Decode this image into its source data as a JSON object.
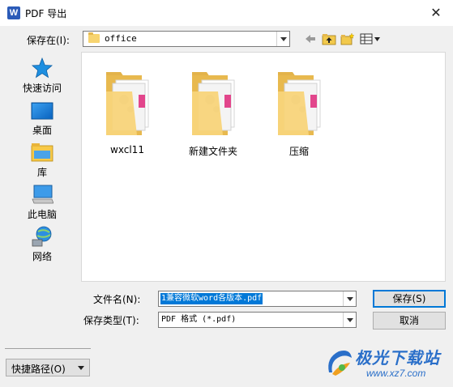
{
  "window": {
    "title": "PDF 导出",
    "app_icon": "W"
  },
  "toolbar": {
    "look_in_label": "保存在(I):",
    "look_in_value": "office"
  },
  "places": [
    {
      "label": "快速访问",
      "icon": "star-icon"
    },
    {
      "label": "桌面",
      "icon": "desktop-icon"
    },
    {
      "label": "库",
      "icon": "library-icon"
    },
    {
      "label": "此电脑",
      "icon": "computer-icon"
    },
    {
      "label": "网络",
      "icon": "network-icon"
    }
  ],
  "files": [
    {
      "name": "wxcl11"
    },
    {
      "name": "新建文件夹"
    },
    {
      "name": "压缩"
    }
  ],
  "form": {
    "filename_label": "文件名(N):",
    "filename_value": "1兼容微软word各版本.pdf",
    "filetype_label": "保存类型(T):",
    "filetype_value": "PDF 格式 (*.pdf)",
    "save_label": "保存(S)",
    "cancel_label": "取消"
  },
  "footer": {
    "shortcut_label": "快捷路径(O)"
  },
  "watermark": {
    "name": "极光下载站",
    "url": "www.xz7.com"
  },
  "colors": {
    "accent": "#0078d7",
    "folder": "#f7d470",
    "watermark": "#2a6fc9"
  }
}
